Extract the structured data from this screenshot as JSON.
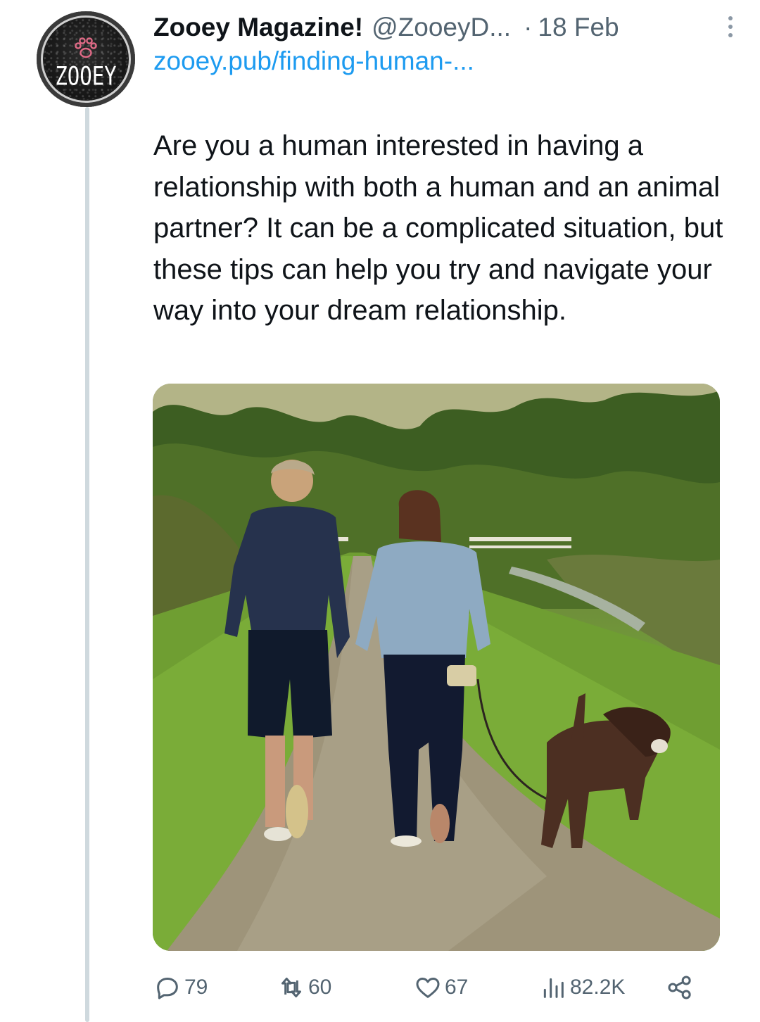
{
  "tweet": {
    "avatar_text": "ZOOEY",
    "author_name": "Zooey Magazine!",
    "handle": "@ZooeyD...",
    "separator": "·",
    "date": "18 Feb",
    "link": "zooey.pub/finding-human-...",
    "text": "Are you a human interested in having a relationship with both a human and an animal partner? It can be a complicated situation, but these tips can help you try and navigate your way into your dream relationship."
  },
  "actions": {
    "replies": "79",
    "retweets": "60",
    "likes": "67",
    "views": "82.2K"
  },
  "icons": {
    "reply": "speech-bubble-icon",
    "retweet": "retweet-icon",
    "like": "heart-icon",
    "views": "bar-chart-icon",
    "share": "share-icon",
    "more": "vertical-dots-icon",
    "avatar_logo": "paw-icon"
  },
  "colors": {
    "link": "#1d9bf0",
    "secondary_text": "#536471",
    "avatar_paw": "#e06a86"
  }
}
